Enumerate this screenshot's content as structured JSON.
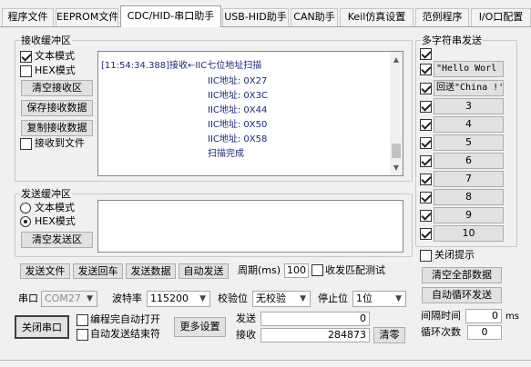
{
  "tabs": [
    {
      "label": "程序文件"
    },
    {
      "label": "EEPROM文件"
    },
    {
      "label": "CDC/HID-串口助手",
      "active": true
    },
    {
      "label": "USB-HID助手"
    },
    {
      "label": "CAN助手"
    },
    {
      "label": "Keil仿真设置"
    },
    {
      "label": "范例程序"
    },
    {
      "label": "I/O口配置"
    }
  ],
  "receive": {
    "title": "接收缓冲区",
    "text_mode": "文本模式",
    "hex_mode": "HEX模式",
    "clear_btn": "清空接收区",
    "save_btn": "保存接收数据",
    "copy_btn": "复制接收数据",
    "to_file": "接收到文件",
    "lines": [
      "[11:54:34.388]接收←IIC七位地址扫描",
      "IIC地址: 0X27",
      "IIC地址: 0X3C",
      "IIC地址: 0X44",
      "IIC地址: 0X50",
      "IIC地址: 0X58",
      "扫描完成"
    ]
  },
  "send": {
    "title": "发送缓冲区",
    "text_mode": "文本模式",
    "hex_mode": "HEX模式",
    "clear_btn": "清空发送区",
    "send_file": "发送文件",
    "send_cr": "发送回车",
    "send_data": "发送数据",
    "auto_send": "自动发送",
    "period_label": "周期(ms)",
    "period_value": "100",
    "match_test": "收发匹配测试"
  },
  "port": {
    "label": "串口",
    "value": "COM27",
    "baud_label": "波特率",
    "baud_value": "115200",
    "parity_label": "校验位",
    "parity_value": "无校验",
    "stop_label": "停止位",
    "stop_value": "1位",
    "close_btn": "关闭串口",
    "auto_open": "编程完自动打开",
    "auto_end": "自动发送结束符",
    "more_btn": "更多设置",
    "sent_label": "发送",
    "sent_value": "0",
    "recv_label": "接收",
    "recv_value": "284873",
    "clear_btn": "清零"
  },
  "multi": {
    "title": "多字符串发送",
    "items": [
      {
        "label": "",
        "checked": true
      },
      {
        "label": "\"Hello Worl",
        "checked": true
      },
      {
        "label": "回送\"China !'",
        "checked": true
      },
      {
        "label": "3",
        "checked": true
      },
      {
        "label": "4",
        "checked": true
      },
      {
        "label": "5",
        "checked": true
      },
      {
        "label": "6",
        "checked": true
      },
      {
        "label": "7",
        "checked": true
      },
      {
        "label": "8",
        "checked": true
      },
      {
        "label": "9",
        "checked": true
      },
      {
        "label": "10",
        "checked": true
      }
    ],
    "close_hint": "关闭提示",
    "clear_all": "清空全部数据",
    "auto_loop": "自动循环发送",
    "interval_label": "间隔时间",
    "interval_value": "0",
    "interval_unit": "ms",
    "loop_label": "循环次数",
    "loop_value": "0"
  }
}
